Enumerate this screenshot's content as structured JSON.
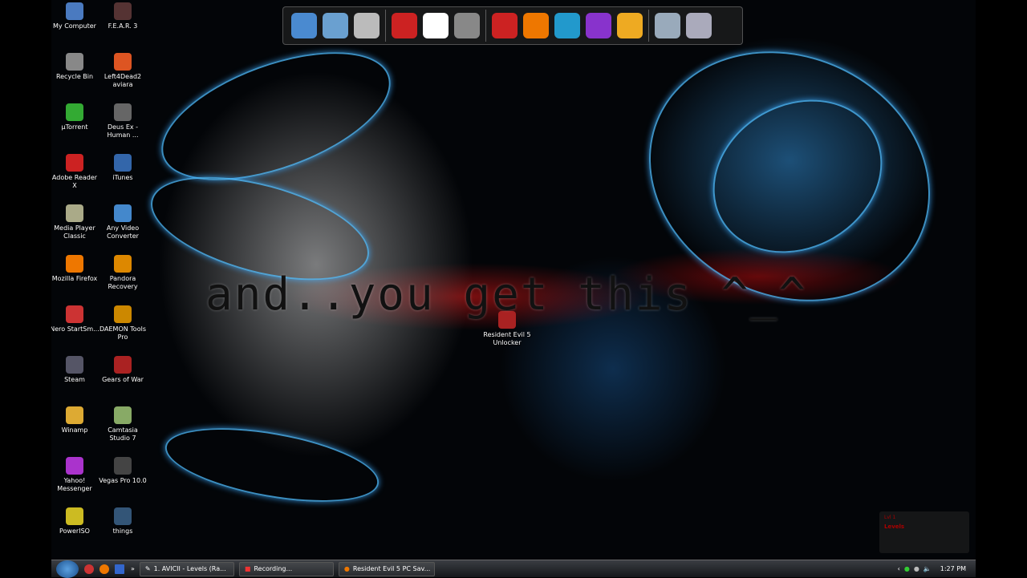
{
  "desktop_icons_col1": [
    "My Computer",
    "Recycle Bin",
    "µTorrent",
    "Adobe Reader X",
    "Media Player Classic",
    "Mozilla Firefox",
    "Nero StartSm...",
    "Steam",
    "Winamp",
    "Yahoo! Messenger",
    "PowerISO"
  ],
  "desktop_icons_col2": [
    "F.E.A.R. 3",
    "Left4Dead2 aviara",
    "Deus Ex - Human ...",
    "iTunes",
    "Any Video Converter",
    "Pandora Recovery",
    "DAEMON Tools Pro",
    "Gears of War",
    "Camtasia Studio 7",
    "Vegas Pro 10.0",
    "things"
  ],
  "desktop_file": "Resident Evil 5 Unlocker",
  "overlay_text": "and..you get this ^_^",
  "dock_icons": [
    "computer-icon",
    "network-icon",
    "drive-icon",
    "gears-of-war-icon",
    "need-for-speed-icon",
    "steam-icon",
    "youtube-icon",
    "firefox-icon",
    "skype-icon",
    "yahoo-messenger-icon",
    "winamp-icon",
    "recycle-bin-icon",
    "settings-icon"
  ],
  "taskbar": {
    "tasks": [
      "1. AVICII - Levels (Ra...",
      "Recording...",
      "Resident Evil 5 PC Sav..."
    ],
    "clock": "1:27 PM"
  },
  "gadget": {
    "title": "Lvl 1",
    "value": "Levels"
  }
}
